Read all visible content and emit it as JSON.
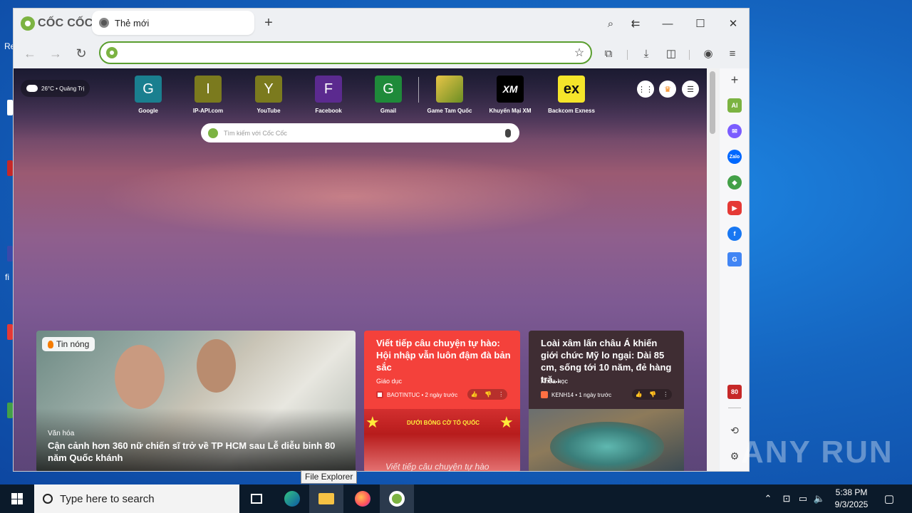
{
  "browser": {
    "brand": "CỐC CỐC",
    "tab_title": "Thẻ mới",
    "omnibox_value": ""
  },
  "newtab": {
    "weather": "26°C • Quảng Trị",
    "search_placeholder": "Tìm kiếm với Cốc Cốc",
    "tiles": [
      {
        "label": "Google",
        "letter": "G",
        "color": "#1a7f8f"
      },
      {
        "label": "IP-API.com",
        "letter": "I",
        "color": "#7b7a1e"
      },
      {
        "label": "YouTube",
        "letter": "Y",
        "color": "#7b7a1e"
      },
      {
        "label": "Facebook",
        "letter": "F",
        "color": "#5b2a8f"
      },
      {
        "label": "Gmail",
        "letter": "G",
        "color": "#1f8a3a"
      },
      {
        "label": "Game Tam Quốc",
        "letter": "",
        "color": "#c9a227"
      },
      {
        "label": "Khuyến Mại XM",
        "letter": "XM",
        "color": "#000000"
      },
      {
        "label": "Backcom Exness",
        "letter": "ex",
        "color": "#f5e52a"
      }
    ]
  },
  "news": {
    "hot_badge": "Tin nóng",
    "main": {
      "category": "Văn hóa",
      "title": "Cận cảnh hơn 360 nữ chiến sĩ trở về TP HCM sau Lễ diễu binh 80 năm Quốc khánh"
    },
    "card2": {
      "title": "Viết tiếp câu chuyện tự hào: Hội nhập vẫn luôn đậm đà bản sắc",
      "category": "Giáo dục",
      "source": "BAOTINTUC • 2 ngày trước",
      "banner": "DƯỚI BÓNG CỜ TỔ QUỐC",
      "caption": "Viết tiếp câu chuyện tự hào"
    },
    "card3": {
      "title": "Loài xâm lấn châu Á khiến giới chức Mỹ lo ngại: Dài 85 cm, sống tới 10 năm, đẻ hàng tră...",
      "category": "Khoa học",
      "source": "KENH14 • 1 ngày trước"
    }
  },
  "sidebar_badge": "80",
  "tooltip": "File Explorer",
  "taskbar": {
    "search_placeholder": "Type here to search",
    "time": "5:38 PM",
    "date": "9/3/2025"
  },
  "desktop_fragments": [
    "Re",
    "fi"
  ],
  "watermark": "ANY RUN"
}
